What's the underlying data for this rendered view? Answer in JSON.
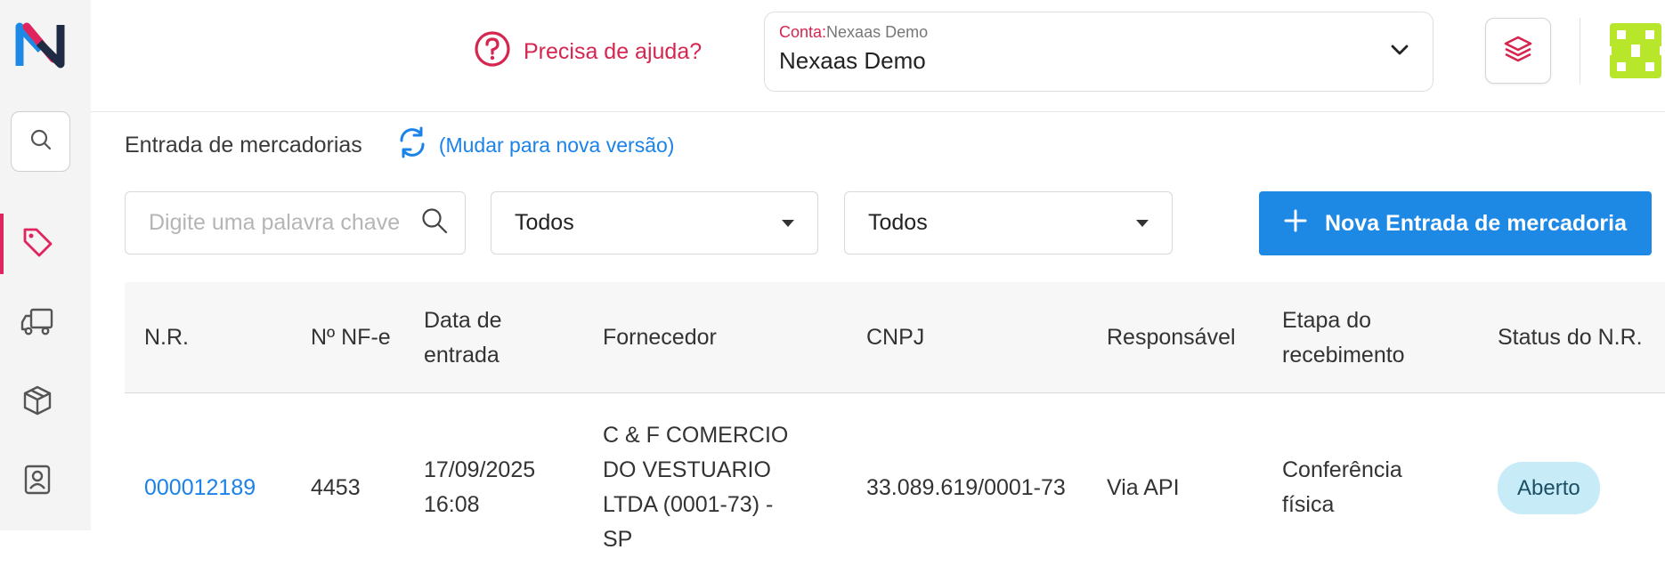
{
  "sidebar": {
    "items": [
      "search-icon",
      "tag-icon",
      "truck-icon",
      "box-icon",
      "contact-icon"
    ],
    "active_color": "#e0245e"
  },
  "header": {
    "help_text": "Precisa de ajuda?",
    "account_prefix": "Conta:",
    "account_label": "Nexaas Demo",
    "account_name": "Nexaas Demo"
  },
  "page": {
    "title": "Entrada de mercadorias",
    "switch_text": "(Mudar para nova versão)"
  },
  "filters": {
    "search_placeholder": "Digite uma palavra chave",
    "select1": "Todos",
    "select2": "Todos",
    "new_button": "Nova Entrada de mercadoria"
  },
  "table": {
    "headers": [
      "N.R.",
      "Nº NF-e",
      "Data de entrada",
      "Fornecedor",
      "CNPJ",
      "Responsável",
      "Etapa do recebimento",
      "Status do N.R."
    ],
    "rows": [
      {
        "nr": "000012189",
        "nfe": "4453",
        "data": "17/09/2025 16:08",
        "fornecedor": "C & F COMERCIO DO VESTUARIO LTDA (0001-73) - SP",
        "cnpj": "33.089.619/0001-73",
        "responsavel": "Via API",
        "etapa": "Conferência física",
        "status": "Aberto"
      }
    ]
  },
  "colors": {
    "accent": "#1e88e5",
    "brand": "#d6254f",
    "badge_bg": "#c7ecf7"
  }
}
